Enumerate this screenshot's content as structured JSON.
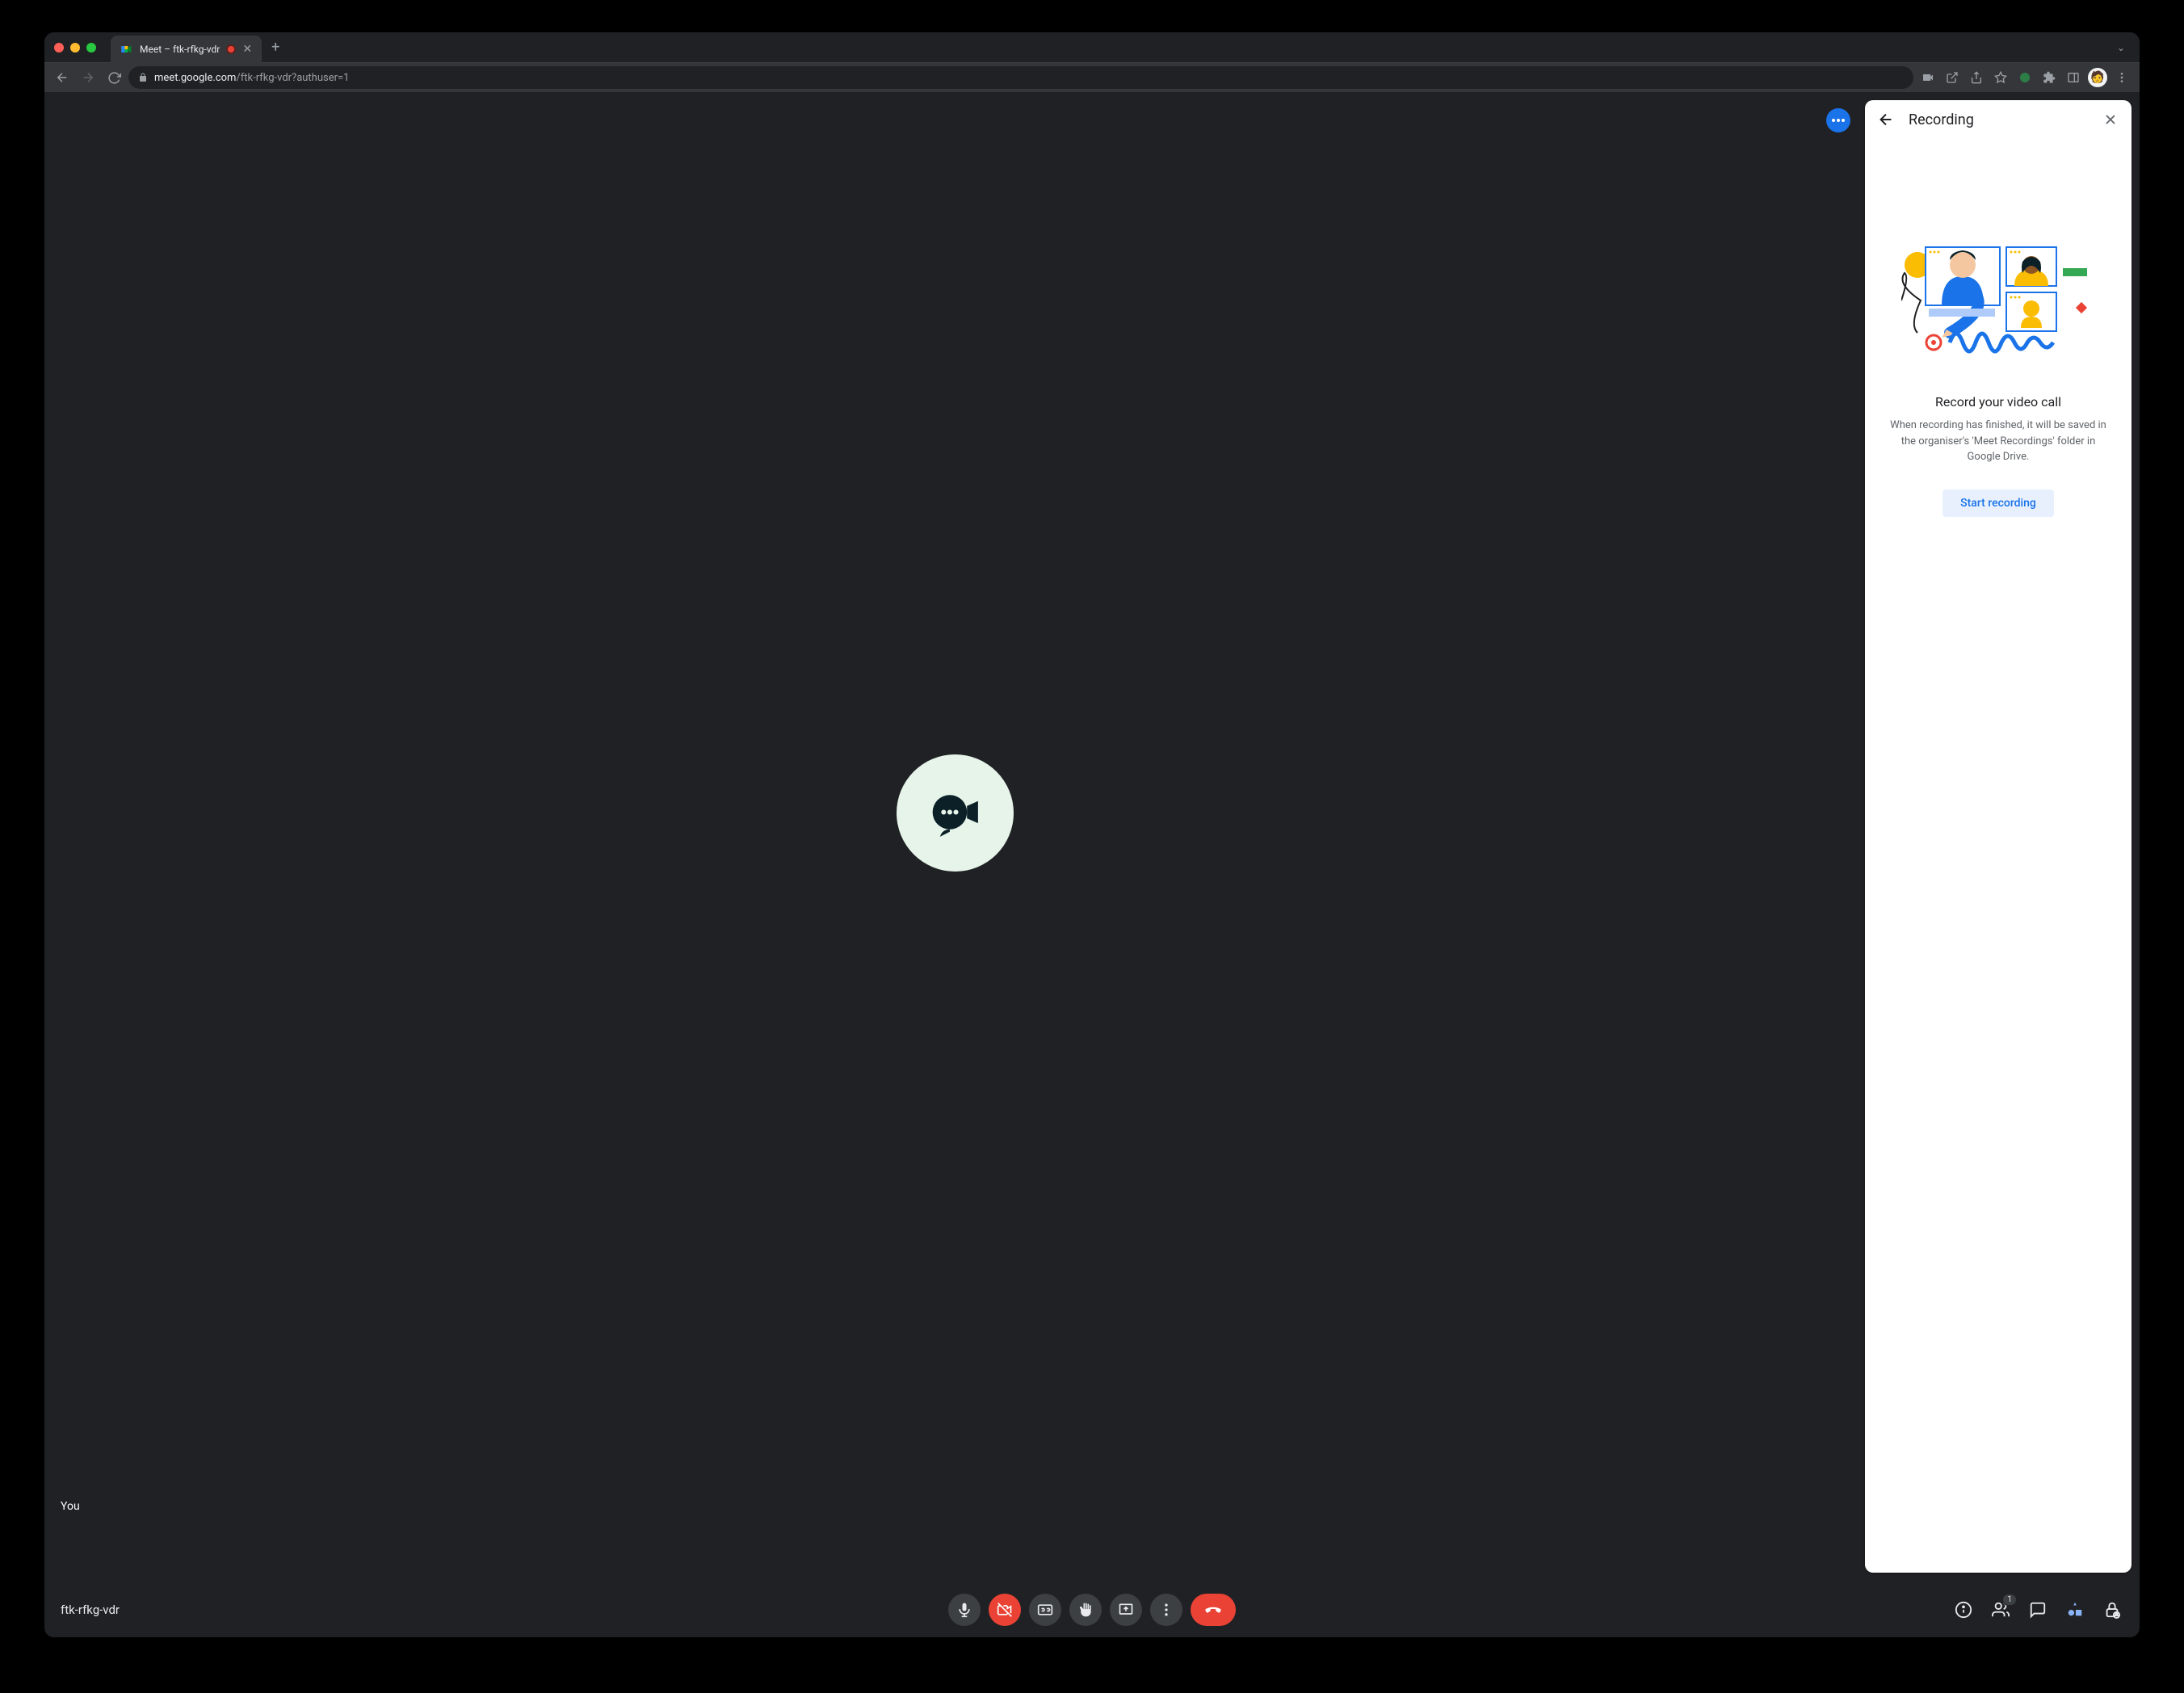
{
  "browser": {
    "tab_title": "Meet – ftk-rfkg-vdr",
    "url_display": "meet.google.com/ftk-rfkg-vdr?authuser=1",
    "url_domain": "meet.google.com",
    "url_path": "/ftk-rfkg-vdr?authuser=1"
  },
  "meet": {
    "participant_label": "You",
    "meeting_code": "ftk-rfkg-vdr",
    "participant_count": "1"
  },
  "panel": {
    "title": "Recording",
    "heading": "Record your video call",
    "description": "When recording has finished, it will be saved in the organiser's 'Meet Recordings' folder in Google Drive.",
    "start_button": "Start recording"
  }
}
